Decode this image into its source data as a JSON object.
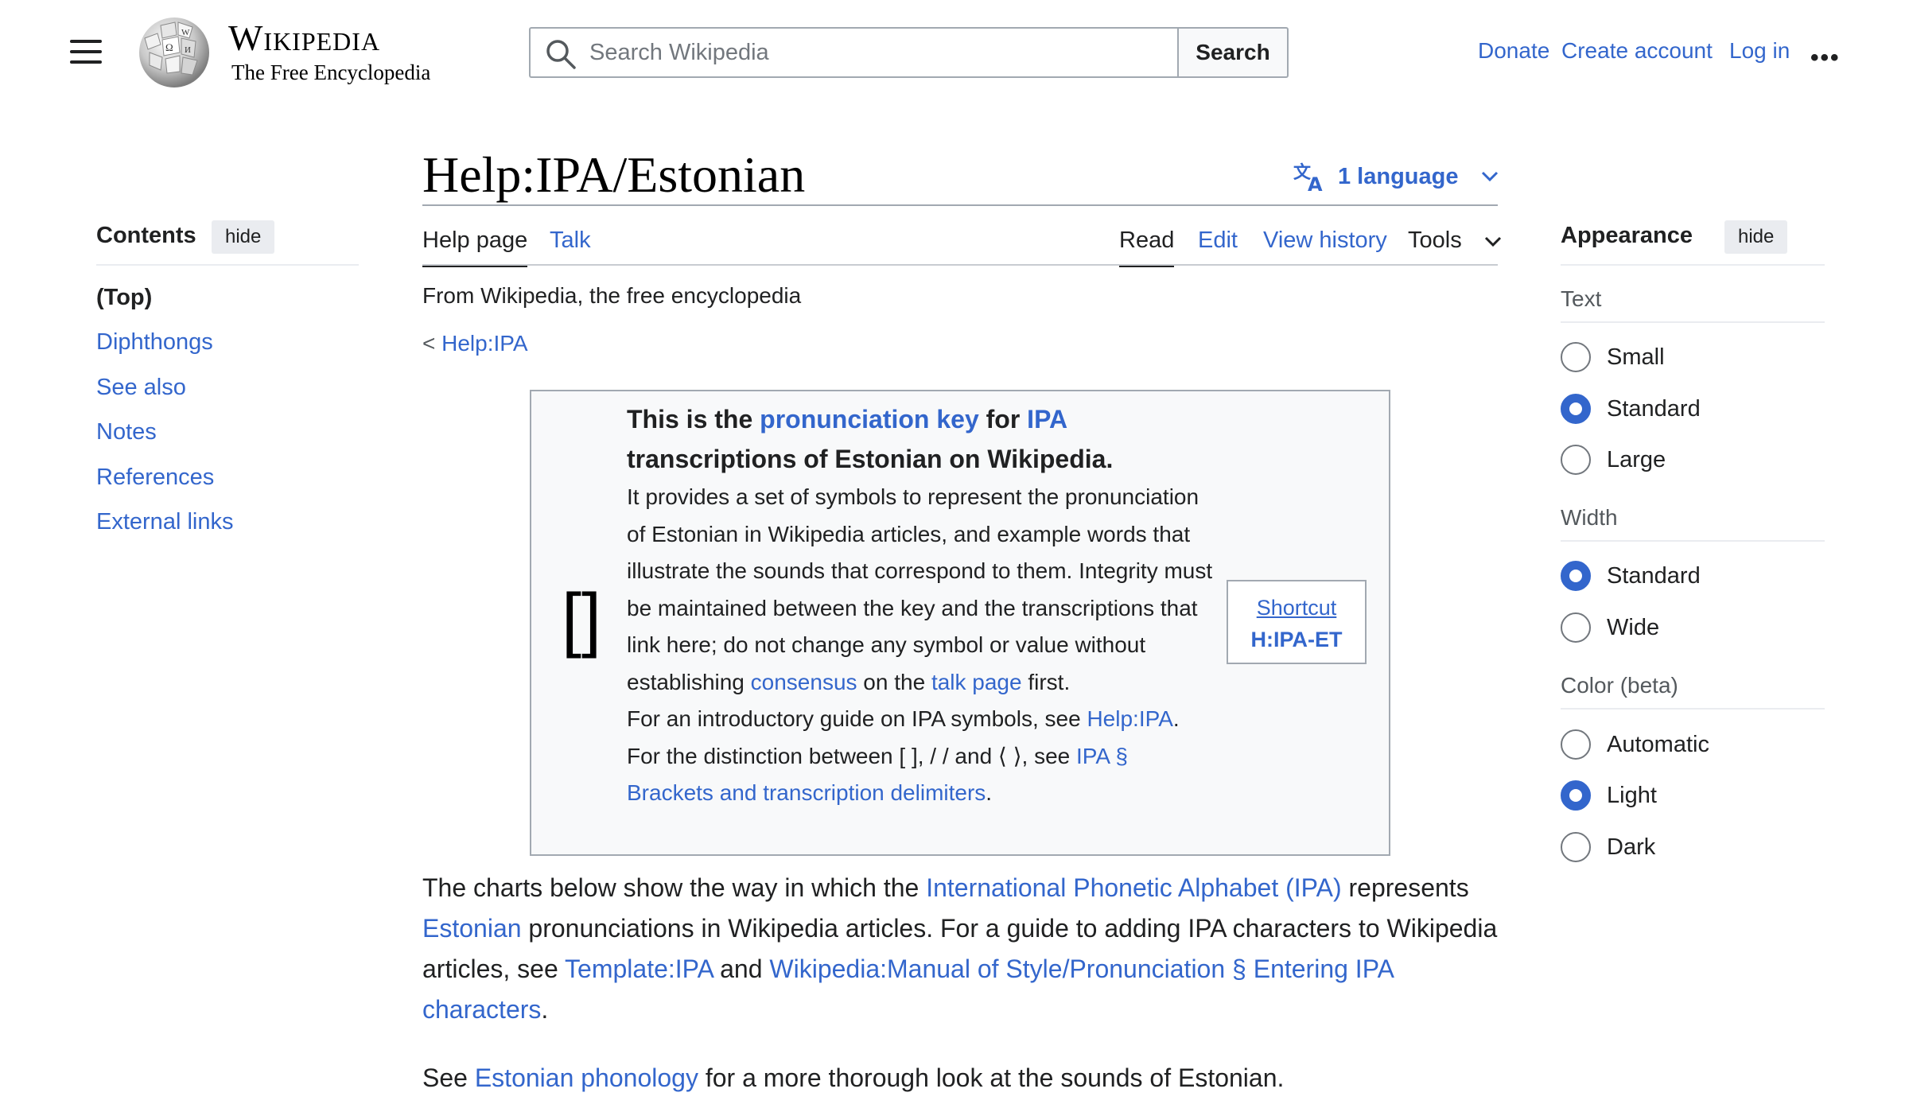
{
  "header": {
    "logo_title": "Wikipedia",
    "logo_tagline": "The Free Encyclopedia",
    "search_placeholder": "Search Wikipedia",
    "search_button": "Search",
    "donate": "Donate",
    "create_account": "Create account",
    "log_in": "Log in",
    "more": "•••"
  },
  "page": {
    "title": "Help:IPA/Estonian",
    "language_button": "1 language",
    "tabs": {
      "help_page": "Help page",
      "talk": "Talk",
      "read": "Read",
      "edit": "Edit",
      "view_history": "View history",
      "tools": "Tools"
    },
    "from_wikipedia": "From Wikipedia, the free encyclopedia",
    "breadcrumb_prefix": "<",
    "breadcrumb_link": "Help:IPA"
  },
  "toc": {
    "title": "Contents",
    "hide": "hide",
    "items": [
      "(Top)",
      "Diphthongs",
      "See also",
      "Notes",
      "References",
      "External links"
    ]
  },
  "ipa_box": {
    "brackets": "[]",
    "lead_1": "This is the ",
    "lead_link_1": "pronunciation key",
    "lead_2": " for ",
    "lead_link_2": "IPA",
    "lead_3": " transcriptions of Estonian on Wikipedia.",
    "body_1": "It provides a set of symbols to represent the pronunciation of Estonian in Wikipedia articles, and example words that illustrate the sounds that correspond to them. Integrity must be maintained between the key and the transcriptions that link here; do not change any symbol or value without establishing ",
    "body_link_1": "consensus",
    "body_2": " on the ",
    "body_link_2": "talk page",
    "body_3": " first.",
    "intro_1": "For an introductory guide on IPA symbols, see ",
    "intro_link": "Help:IPA",
    "intro_2": ".",
    "dist_1": "For the distinction between [ ], / / and ⟨ ⟩, see ",
    "dist_link_1": "IPA",
    "dist_link_2": "§ Brackets and transcription delimiters",
    "dist_2": ".",
    "shortcut_label": "Shortcut",
    "shortcut_code": "H:IPA-ET"
  },
  "content": {
    "p1_1": "The charts below show the way in which the ",
    "p1_link_1": "International Phonetic Alphabet (IPA)",
    "p1_2": " represents ",
    "p1_link_2": "Estonian",
    "p1_3": " pronunciations in Wikipedia articles. For a guide to adding IPA characters to Wikipedia articles, see ",
    "p1_link_3": "Template:IPA",
    "p1_4": " and ",
    "p1_link_4": "Wikipedia:Manual of Style/Pronunciation § Entering IPA characters",
    "p1_5": ".",
    "p2_1": "See ",
    "p2_link": "Estonian phonology",
    "p2_2": " for a more thorough look at the sounds of Estonian."
  },
  "appearance": {
    "title": "Appearance",
    "hide": "hide",
    "text_label": "Text",
    "text_options": [
      "Small",
      "Standard",
      "Large"
    ],
    "text_selected": "Standard",
    "width_label": "Width",
    "width_options": [
      "Standard",
      "Wide"
    ],
    "width_selected": "Standard",
    "color_label": "Color (beta)",
    "color_options": [
      "Automatic",
      "Light",
      "Dark"
    ],
    "color_selected": "Light",
    "accent_color": "#3366cc"
  }
}
